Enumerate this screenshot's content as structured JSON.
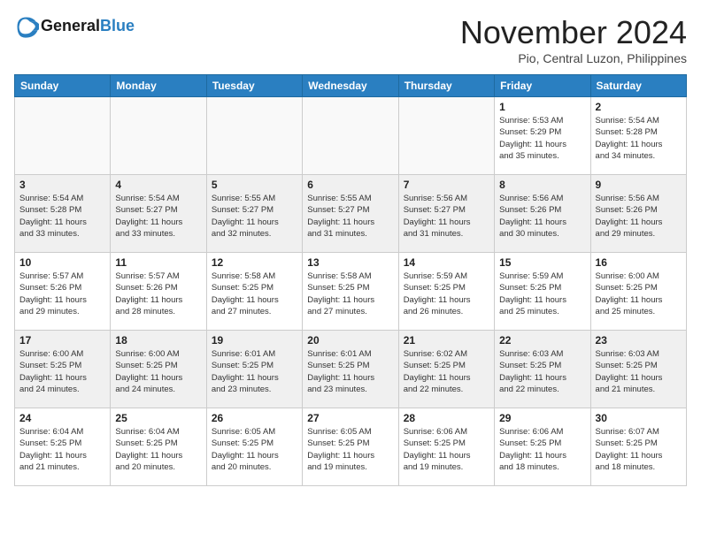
{
  "header": {
    "logo_general": "General",
    "logo_blue": "Blue",
    "month_title": "November 2024",
    "location": "Pio, Central Luzon, Philippines"
  },
  "weekdays": [
    "Sunday",
    "Monday",
    "Tuesday",
    "Wednesday",
    "Thursday",
    "Friday",
    "Saturday"
  ],
  "weeks": [
    [
      {
        "day": "",
        "info": ""
      },
      {
        "day": "",
        "info": ""
      },
      {
        "day": "",
        "info": ""
      },
      {
        "day": "",
        "info": ""
      },
      {
        "day": "",
        "info": ""
      },
      {
        "day": "1",
        "info": "Sunrise: 5:53 AM\nSunset: 5:29 PM\nDaylight: 11 hours\nand 35 minutes."
      },
      {
        "day": "2",
        "info": "Sunrise: 5:54 AM\nSunset: 5:28 PM\nDaylight: 11 hours\nand 34 minutes."
      }
    ],
    [
      {
        "day": "3",
        "info": "Sunrise: 5:54 AM\nSunset: 5:28 PM\nDaylight: 11 hours\nand 33 minutes."
      },
      {
        "day": "4",
        "info": "Sunrise: 5:54 AM\nSunset: 5:27 PM\nDaylight: 11 hours\nand 33 minutes."
      },
      {
        "day": "5",
        "info": "Sunrise: 5:55 AM\nSunset: 5:27 PM\nDaylight: 11 hours\nand 32 minutes."
      },
      {
        "day": "6",
        "info": "Sunrise: 5:55 AM\nSunset: 5:27 PM\nDaylight: 11 hours\nand 31 minutes."
      },
      {
        "day": "7",
        "info": "Sunrise: 5:56 AM\nSunset: 5:27 PM\nDaylight: 11 hours\nand 31 minutes."
      },
      {
        "day": "8",
        "info": "Sunrise: 5:56 AM\nSunset: 5:26 PM\nDaylight: 11 hours\nand 30 minutes."
      },
      {
        "day": "9",
        "info": "Sunrise: 5:56 AM\nSunset: 5:26 PM\nDaylight: 11 hours\nand 29 minutes."
      }
    ],
    [
      {
        "day": "10",
        "info": "Sunrise: 5:57 AM\nSunset: 5:26 PM\nDaylight: 11 hours\nand 29 minutes."
      },
      {
        "day": "11",
        "info": "Sunrise: 5:57 AM\nSunset: 5:26 PM\nDaylight: 11 hours\nand 28 minutes."
      },
      {
        "day": "12",
        "info": "Sunrise: 5:58 AM\nSunset: 5:25 PM\nDaylight: 11 hours\nand 27 minutes."
      },
      {
        "day": "13",
        "info": "Sunrise: 5:58 AM\nSunset: 5:25 PM\nDaylight: 11 hours\nand 27 minutes."
      },
      {
        "day": "14",
        "info": "Sunrise: 5:59 AM\nSunset: 5:25 PM\nDaylight: 11 hours\nand 26 minutes."
      },
      {
        "day": "15",
        "info": "Sunrise: 5:59 AM\nSunset: 5:25 PM\nDaylight: 11 hours\nand 25 minutes."
      },
      {
        "day": "16",
        "info": "Sunrise: 6:00 AM\nSunset: 5:25 PM\nDaylight: 11 hours\nand 25 minutes."
      }
    ],
    [
      {
        "day": "17",
        "info": "Sunrise: 6:00 AM\nSunset: 5:25 PM\nDaylight: 11 hours\nand 24 minutes."
      },
      {
        "day": "18",
        "info": "Sunrise: 6:00 AM\nSunset: 5:25 PM\nDaylight: 11 hours\nand 24 minutes."
      },
      {
        "day": "19",
        "info": "Sunrise: 6:01 AM\nSunset: 5:25 PM\nDaylight: 11 hours\nand 23 minutes."
      },
      {
        "day": "20",
        "info": "Sunrise: 6:01 AM\nSunset: 5:25 PM\nDaylight: 11 hours\nand 23 minutes."
      },
      {
        "day": "21",
        "info": "Sunrise: 6:02 AM\nSunset: 5:25 PM\nDaylight: 11 hours\nand 22 minutes."
      },
      {
        "day": "22",
        "info": "Sunrise: 6:03 AM\nSunset: 5:25 PM\nDaylight: 11 hours\nand 22 minutes."
      },
      {
        "day": "23",
        "info": "Sunrise: 6:03 AM\nSunset: 5:25 PM\nDaylight: 11 hours\nand 21 minutes."
      }
    ],
    [
      {
        "day": "24",
        "info": "Sunrise: 6:04 AM\nSunset: 5:25 PM\nDaylight: 11 hours\nand 21 minutes."
      },
      {
        "day": "25",
        "info": "Sunrise: 6:04 AM\nSunset: 5:25 PM\nDaylight: 11 hours\nand 20 minutes."
      },
      {
        "day": "26",
        "info": "Sunrise: 6:05 AM\nSunset: 5:25 PM\nDaylight: 11 hours\nand 20 minutes."
      },
      {
        "day": "27",
        "info": "Sunrise: 6:05 AM\nSunset: 5:25 PM\nDaylight: 11 hours\nand 19 minutes."
      },
      {
        "day": "28",
        "info": "Sunrise: 6:06 AM\nSunset: 5:25 PM\nDaylight: 11 hours\nand 19 minutes."
      },
      {
        "day": "29",
        "info": "Sunrise: 6:06 AM\nSunset: 5:25 PM\nDaylight: 11 hours\nand 18 minutes."
      },
      {
        "day": "30",
        "info": "Sunrise: 6:07 AM\nSunset: 5:25 PM\nDaylight: 11 hours\nand 18 minutes."
      }
    ]
  ]
}
